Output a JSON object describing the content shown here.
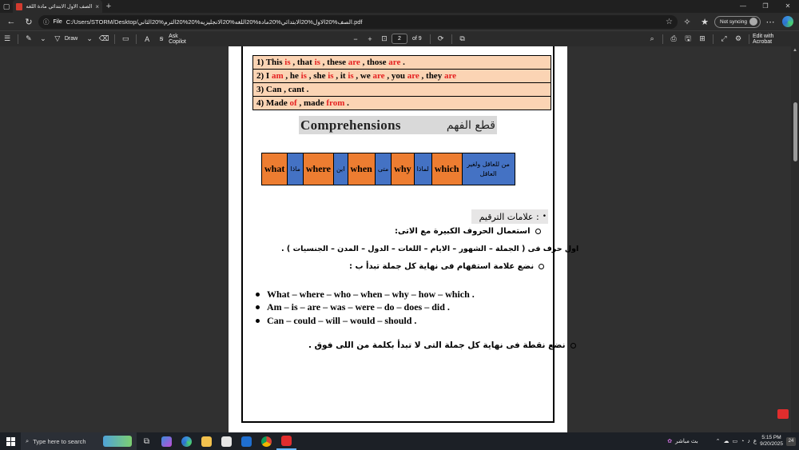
{
  "browser": {
    "tab_title": "الصف الاول الابتدائي مادة اللغه الا...",
    "address_label": "File",
    "url": "C:/Users/STORM/Desktop/الصف%20الاول%20الابتدائي%20مادة%20اللغه%20الانجليزيه%20%20الترم%20الثاني.pdf",
    "sync_label": "Not syncing"
  },
  "pdf_toolbar": {
    "draw_label": "Draw",
    "ask_label": "Ask Copilot",
    "page_current": "2",
    "page_total": "of 9",
    "edit_label": "Edit with Acrobat"
  },
  "document": {
    "rules": [
      [
        {
          "t": "1) This "
        },
        {
          "t": "is",
          "red": true
        },
        {
          "t": " , that "
        },
        {
          "t": "is",
          "red": true
        },
        {
          "t": " , these "
        },
        {
          "t": "are",
          "red": true
        },
        {
          "t": " , those "
        },
        {
          "t": "are",
          "red": true
        },
        {
          "t": " ."
        }
      ],
      [
        {
          "t": "2) I "
        },
        {
          "t": "am",
          "red": true
        },
        {
          "t": " , he "
        },
        {
          "t": "is",
          "red": true
        },
        {
          "t": " , she "
        },
        {
          "t": "is",
          "red": true
        },
        {
          "t": " , it "
        },
        {
          "t": "is",
          "red": true
        },
        {
          "t": " , we "
        },
        {
          "t": "are",
          "red": true
        },
        {
          "t": " , you "
        },
        {
          "t": "are",
          "red": true
        },
        {
          "t": " , they "
        },
        {
          "t": "are",
          "red": true
        }
      ],
      [
        {
          "t": "3) Can , cant ."
        }
      ],
      [
        {
          "t": "4) Made "
        },
        {
          "t": "of",
          "red": true
        },
        {
          "t": " , made "
        },
        {
          "t": "from",
          "red": true
        },
        {
          "t": " ."
        }
      ]
    ],
    "comprehension_en": "Comprehensions",
    "comprehension_ar": "قطع الفهم",
    "question_words": [
      {
        "en": "what",
        "ar": "ماذا"
      },
      {
        "en": "where",
        "ar": "اين"
      },
      {
        "en": "when",
        "ar": "متى"
      },
      {
        "en": "why",
        "ar": "لماذا"
      },
      {
        "en": "which",
        "ar": "من للعاقل ولغير العاقل"
      }
    ],
    "punctuation_heading": "علامات الترقيم :",
    "capital_rule": "استعمال الحروف الكبيرة مع الاتى:",
    "capital_detail": "اول حرف فى ( الجملة – الشهور – الايام – اللغات – الدول – المدن – الجنسيات ) .",
    "question_mark_rule": "نضع علامة استفهام فى نهاية كل جملة تبدأ ب :",
    "question_starters": [
      "What – where – who – when – why – how – which .",
      "Am – is – are – was – were – do – does – did .",
      "Can – could – will – would – should ."
    ],
    "period_rule": "نضع نقطة فى نهاية كل جملة التى لا تبدأ بكلمة من اللى فوق ."
  },
  "taskbar": {
    "search_placeholder": "Type here to search",
    "tray_live_label": "بث مباشر",
    "time": "5:15 PM",
    "date": "9/20/2025",
    "notifications": "24"
  },
  "colors": {
    "orange_cell": "#ed7d31",
    "blue_cell": "#4472c4",
    "rule_row": "#fbd4b4",
    "red_text": "#e52020"
  }
}
